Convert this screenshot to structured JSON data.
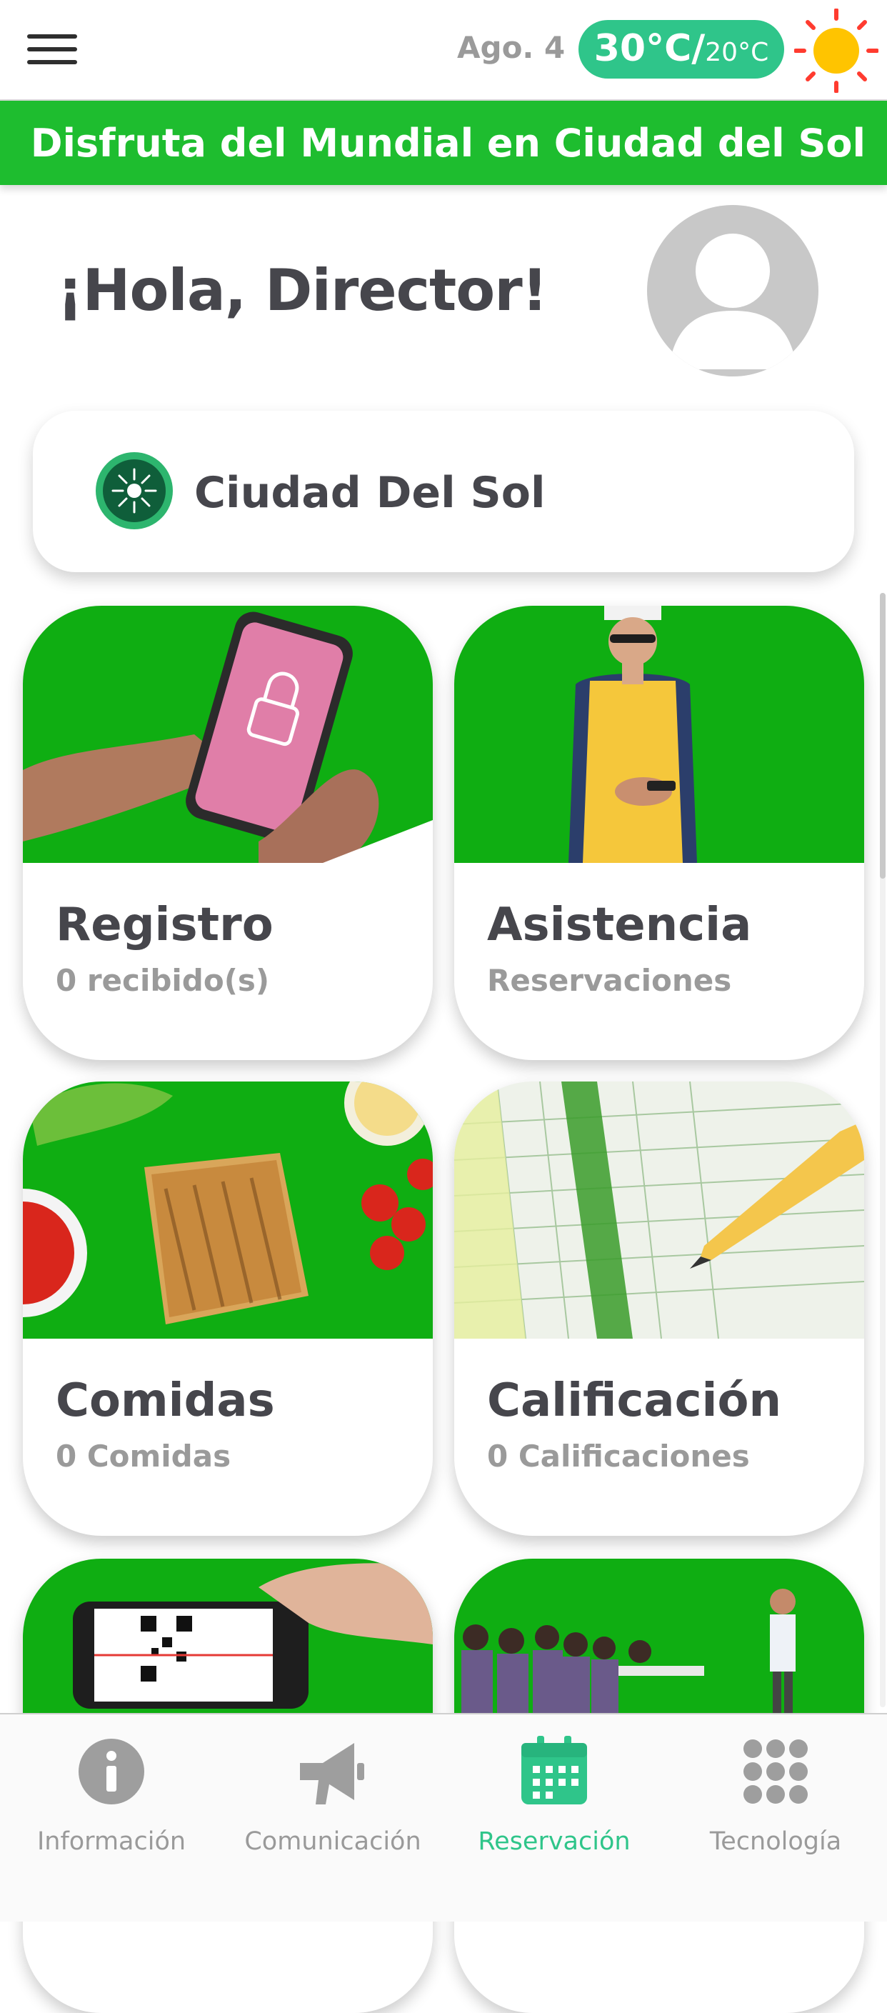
{
  "header": {
    "date": "Ago. 4",
    "temp_high": "30°C",
    "temp_sep": "/",
    "temp_low": "20°C",
    "weather_icon": "sun-icon",
    "accent": "#2fc58a"
  },
  "banner": {
    "text": "Disfruta del Mundial en Ciudad del Sol",
    "color": "#1ebd2f"
  },
  "greeting": "¡Hola, Director!",
  "school": {
    "name": "Ciudad Del Sol",
    "logo_icon": "sun-emblem-icon"
  },
  "cards": [
    {
      "title": "Registro",
      "subtitle": "0 recibido(s)",
      "image": "phone-lock-image"
    },
    {
      "title": "Asistencia",
      "subtitle": "Reservaciones",
      "image": "staff-clipboard-image"
    },
    {
      "title": "Comidas",
      "subtitle": "0 Comidas",
      "image": "sandwich-image"
    },
    {
      "title": "Calificación",
      "subtitle": "0 Calificaciones",
      "image": "scorecard-image"
    },
    {
      "title": "",
      "subtitle": "",
      "image": "qr-scan-image"
    },
    {
      "title": "",
      "subtitle": "",
      "image": "classroom-image"
    }
  ],
  "bottom_nav": [
    {
      "label": "Información",
      "icon": "info-icon",
      "active": false
    },
    {
      "label": "Comunicación",
      "icon": "megaphone-icon",
      "active": false
    },
    {
      "label": "Reservación",
      "icon": "calendar-icon",
      "active": true
    },
    {
      "label": "Tecnología",
      "icon": "grid-dots-icon",
      "active": false
    }
  ],
  "colors": {
    "brand_green": "#0fae12",
    "text_dark": "#46464c",
    "text_muted": "#9a9a9a",
    "nav_active": "#2fc58a"
  }
}
